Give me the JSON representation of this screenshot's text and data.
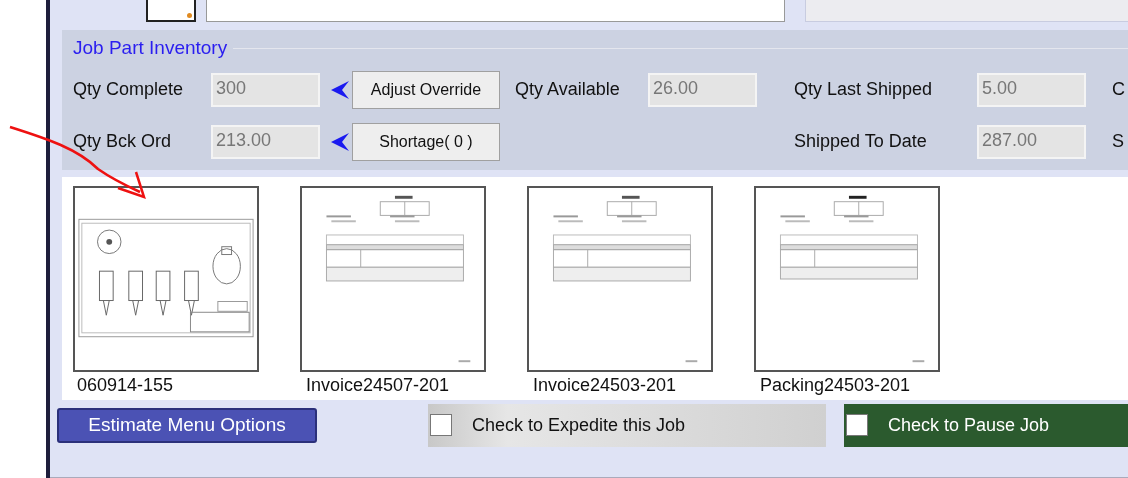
{
  "job_part_inventory": {
    "title": "Job Part Inventory",
    "columns": [
      [
        {
          "kind": "field",
          "label": "Qty Complete",
          "value": "300"
        },
        {
          "kind": "field",
          "label": "Qty Bck Ord",
          "value": "213.00"
        }
      ],
      [
        {
          "kind": "button",
          "label": "Adjust Override"
        },
        {
          "kind": "button",
          "label": "Shortage( 0 )"
        }
      ],
      [
        {
          "kind": "field",
          "label": "Qty Available",
          "value": "26.00"
        }
      ],
      [
        {
          "kind": "field",
          "label": "Qty Last Shipped",
          "value": "5.00"
        },
        {
          "kind": "field",
          "label": "Shipped To Date",
          "value": "287.00"
        }
      ],
      [
        {
          "kind": "label",
          "label": "C"
        },
        {
          "kind": "label",
          "label": "S"
        }
      ]
    ]
  },
  "documents": [
    {
      "kind": "drawing",
      "caption": "060914-155"
    },
    {
      "kind": "invoice",
      "caption": "Invoice24507-201"
    },
    {
      "kind": "invoice",
      "caption": "Invoice24503-201"
    },
    {
      "kind": "packing",
      "caption": "Packing24503-201"
    }
  ],
  "bottom_bar": {
    "button": "Estimate Menu Options",
    "checks": [
      {
        "kind": "gray",
        "label": "Check to Expedite this Job",
        "checked": false
      },
      {
        "kind": "green",
        "label": "Check to Pause Job",
        "checked": false
      }
    ]
  }
}
